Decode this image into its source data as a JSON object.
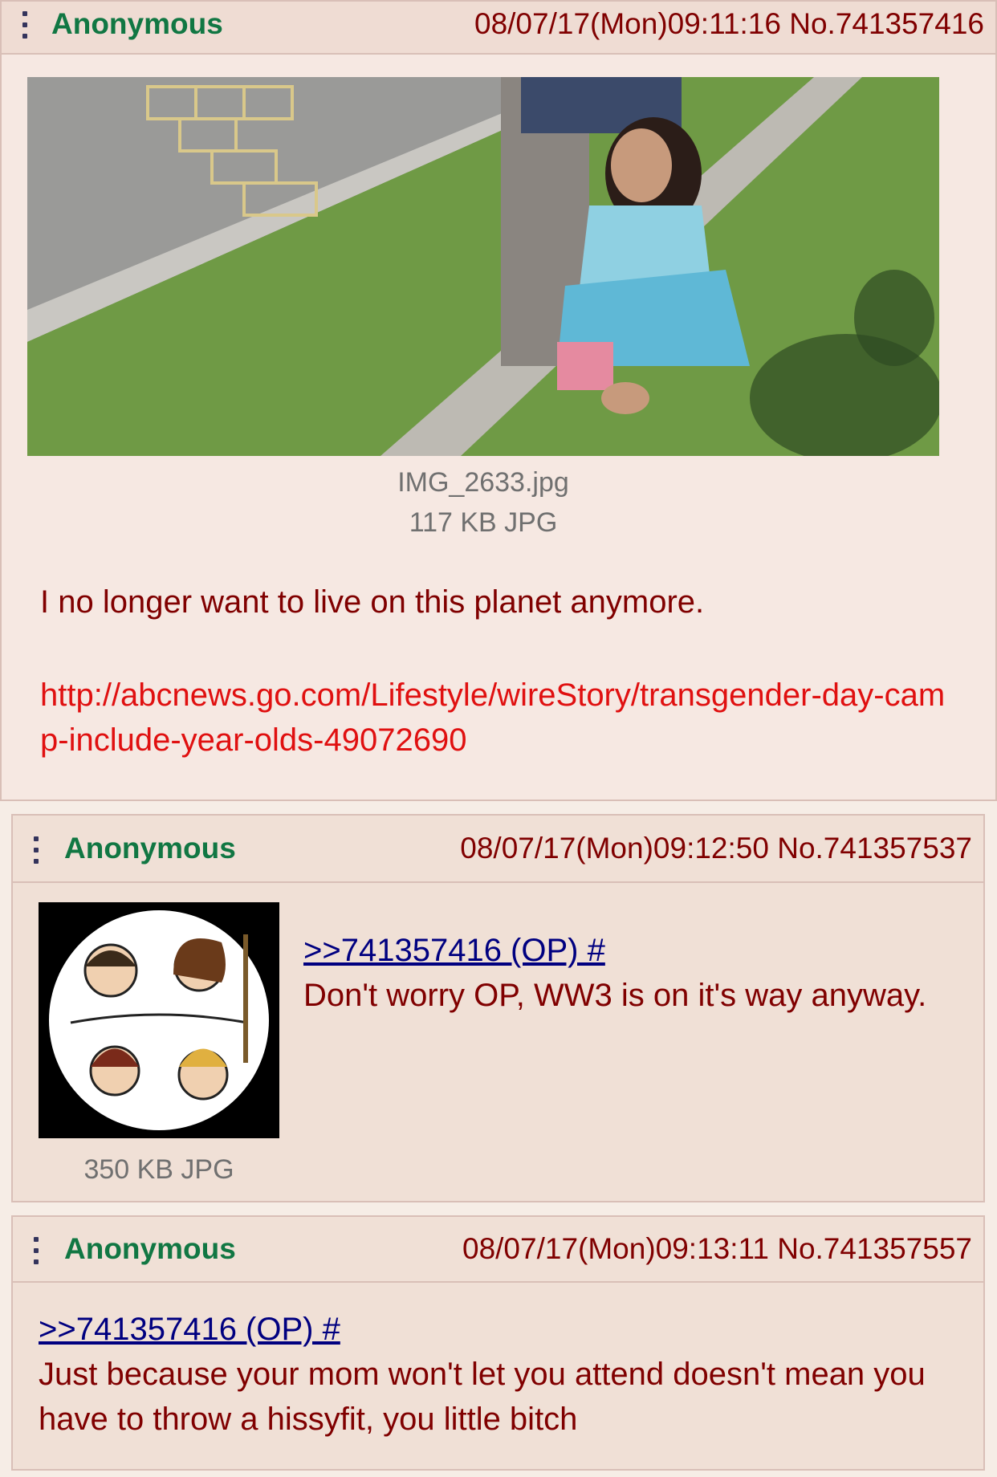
{
  "posts": [
    {
      "name": "Anonymous",
      "datetime": "08/07/17(Mon)09:11:16",
      "number": "No.741357416",
      "file": {
        "filename": "IMG_2633.jpg",
        "size": "117 KB JPG",
        "icon": "photo-child-with-adult-on-playground"
      },
      "comment": "I no longer want to live on this planet anymore.",
      "link": "http://abcnews.go.com/Lifestyle/wireStory/transgender-day-camp-include-year-olds-49072690"
    },
    {
      "name": "Anonymous",
      "datetime": "08/07/17(Mon)09:12:50",
      "number": "No.741357537",
      "file": {
        "size": "350 KB JPG",
        "icon": "illustration-circle-thumbnail"
      },
      "quote": ">>741357416 (OP) #",
      "comment": "Don't worry OP, WW3 is on it's way anyway."
    },
    {
      "name": "Anonymous",
      "datetime": "08/07/17(Mon)09:13:11",
      "number": "No.741357557",
      "quote": ">>741357416 (OP) #",
      "comment": "Just because your mom won't let you attend doesn't mean you have to throw a hissyfit, you little bitch"
    }
  ],
  "colors": {
    "name": "#117743",
    "text": "#800000",
    "quotelink": "#000080",
    "url": "#e01010",
    "post_bg": "#f0e0d6",
    "border": "#d9bfb7"
  }
}
